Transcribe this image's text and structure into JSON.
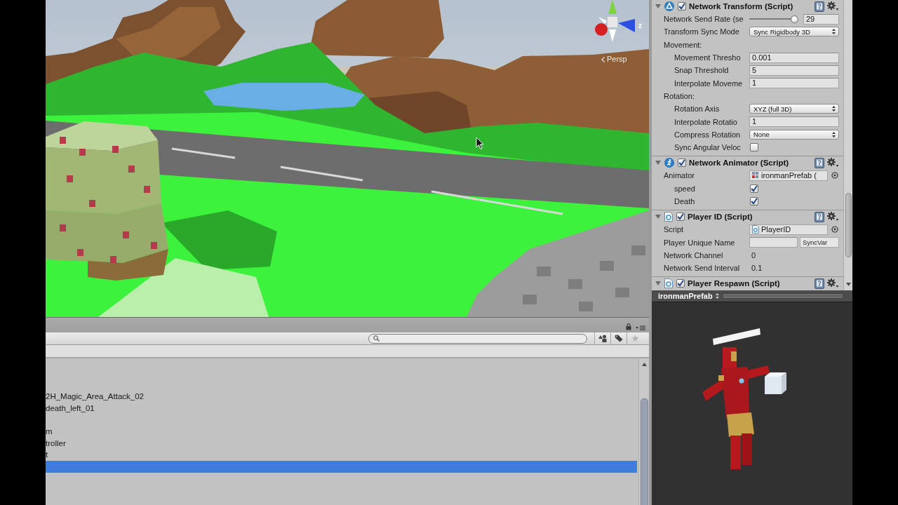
{
  "scene_view": {
    "gizmo": {
      "axis_label": "z",
      "projection": "Persp"
    }
  },
  "inspector": {
    "components": [
      {
        "title": "Network Transform (Script)",
        "kind": "network",
        "enabled": true,
        "expanded": true,
        "fields": [
          {
            "kind": "slider",
            "label": "Network Send Rate (se",
            "level": 0.97,
            "value": "29"
          },
          {
            "kind": "dropdown",
            "label": "Transform Sync Mode",
            "value": "Sync Rigidbody 3D"
          },
          {
            "kind": "section",
            "label": "Movement:",
            "children": [
              {
                "kind": "text",
                "label": "Movement Thresho",
                "value": "0.001"
              },
              {
                "kind": "text",
                "label": "Snap Threshold",
                "value": "5"
              },
              {
                "kind": "text",
                "label": "Interpolate Moveme",
                "value": "1"
              }
            ]
          },
          {
            "kind": "section",
            "label": "Rotation:",
            "children": [
              {
                "kind": "dropdown",
                "label": "Rotation Axis",
                "value": "XYZ (full 3D)"
              },
              {
                "kind": "text",
                "label": "Interpolate Rotatio",
                "value": "1"
              },
              {
                "kind": "dropdown",
                "label": "Compress Rotation",
                "value": "None"
              },
              {
                "kind": "checkbox",
                "label": "Sync Angular Veloc",
                "checked": false
              }
            ]
          }
        ]
      },
      {
        "title": "Network Animator (Script)",
        "kind": "animator",
        "enabled": true,
        "expanded": true,
        "fields": [
          {
            "kind": "animator_object",
            "label": "Animator",
            "value": "ironmanPrefab (",
            "children": [
              {
                "kind": "checkbox",
                "label": "speed",
                "checked": true
              },
              {
                "kind": "checkbox",
                "label": "Death",
                "checked": true
              }
            ]
          }
        ]
      },
      {
        "title": "Player ID (Script)",
        "kind": "script",
        "enabled": true,
        "expanded": true,
        "fields": [
          {
            "kind": "script_object",
            "label": "Script",
            "value": "PlayerID"
          },
          {
            "kind": "syncvar",
            "label": "Player Unique Name",
            "tag": "SyncVar"
          },
          {
            "kind": "readonly",
            "label": "Network Channel",
            "value": "0"
          },
          {
            "kind": "readonly",
            "label": "Network Send Interval",
            "value": "0.1"
          }
        ]
      },
      {
        "title": "Player Respawn (Script)",
        "kind": "script",
        "enabled": true,
        "expanded": true
      }
    ]
  },
  "project": {
    "rows": [
      {
        "text": "2H_Magic_Area_Attack_02",
        "selected": false
      },
      {
        "text": "death_left_01",
        "selected": false
      },
      {
        "selected": false
      },
      {
        "text": "m",
        "selected": false
      },
      {
        "text": "troller",
        "selected": false
      },
      {
        "text": "t",
        "selected": false
      },
      {
        "selected": true
      }
    ]
  },
  "preview": {
    "title": "ironmanPrefab"
  }
}
